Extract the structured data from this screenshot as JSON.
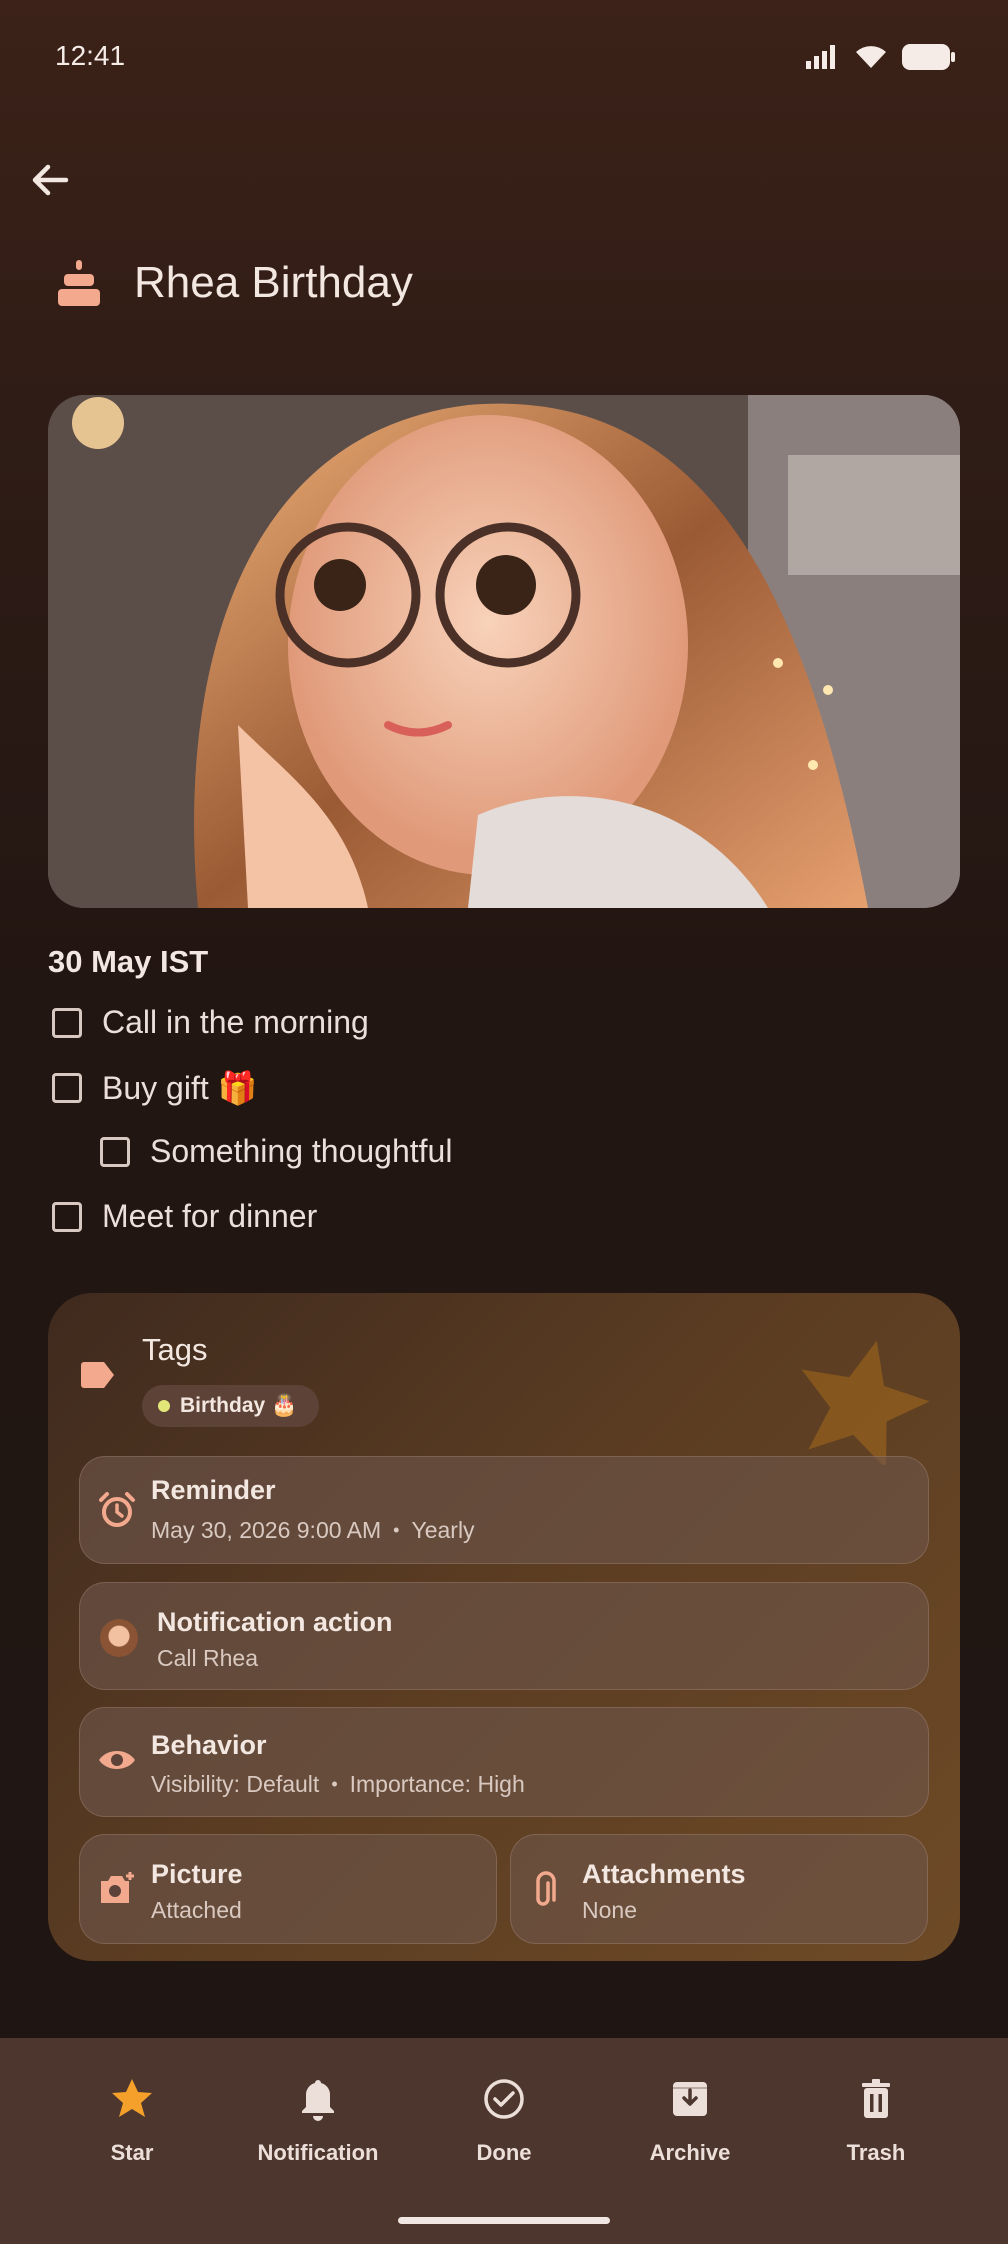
{
  "status_bar": {
    "time": "12:41"
  },
  "header": {
    "title": "Rhea Birthday"
  },
  "note": {
    "date_heading": "30 May IST",
    "checklist": [
      {
        "label": "Call in the morning",
        "checked": false,
        "indent": 0
      },
      {
        "label": "Buy gift 🎁",
        "checked": false,
        "indent": 0
      },
      {
        "label": "Something thoughtful",
        "checked": false,
        "indent": 1
      },
      {
        "label": "Meet for dinner",
        "checked": false,
        "indent": 0
      }
    ]
  },
  "details": {
    "tags_label": "Tags",
    "tag_chip": "Birthday 🎂",
    "reminder": {
      "title": "Reminder",
      "date": "May 30, 2026 9:00 AM",
      "repeat": "Yearly"
    },
    "notification_action": {
      "title": "Notification action",
      "value": "Call Rhea"
    },
    "behavior": {
      "title": "Behavior",
      "visibility": "Visibility: Default",
      "importance": "Importance: High"
    },
    "picture": {
      "title": "Picture",
      "value": "Attached"
    },
    "attachments": {
      "title": "Attachments",
      "value": "None"
    }
  },
  "bottom_nav": {
    "star": "Star",
    "notification": "Notification",
    "done": "Done",
    "archive": "Archive",
    "trash": "Trash"
  },
  "colors": {
    "accent": "#f3a98e",
    "star": "#f4a02a",
    "background": "#221612"
  }
}
